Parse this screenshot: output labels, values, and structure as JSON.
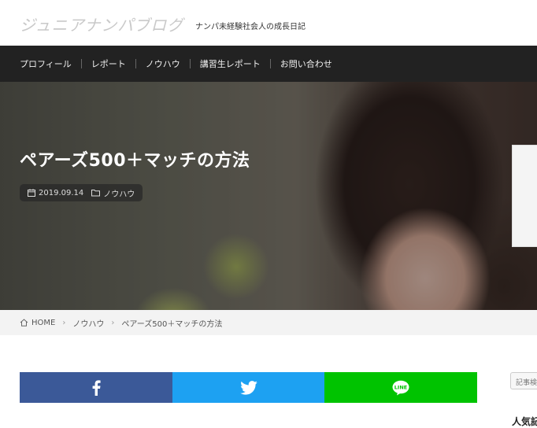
{
  "header": {
    "site_title": "ジュニアナンパブログ",
    "tagline": "ナンパ未経験社会人の成長日記"
  },
  "nav": {
    "items": [
      {
        "label": "プロフィール"
      },
      {
        "label": "レポート"
      },
      {
        "label": "ノウハウ"
      },
      {
        "label": "講習生レポート"
      },
      {
        "label": "お問い合わせ"
      }
    ]
  },
  "hero": {
    "title": "ペアーズ500＋マッチの方法",
    "date": "2019.09.14",
    "category": "ノウハウ"
  },
  "breadcrumb": {
    "home": "HOME",
    "category": "ノウハウ",
    "current": "ペアーズ500＋マッチの方法"
  },
  "share": {
    "facebook_color": "#3b5998",
    "twitter_color": "#1da1f2",
    "line_color": "#00c300",
    "line_text": "LINE"
  },
  "sidebar": {
    "search_placeholder": "記事検",
    "heading": "人気記"
  }
}
